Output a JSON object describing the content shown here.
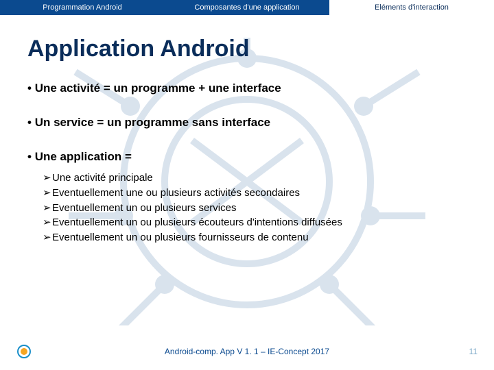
{
  "tabs": {
    "t0": "Programmation Android",
    "t1": "Composantes d'une application",
    "t2": "Eléments d'interaction"
  },
  "title": "Application Android",
  "bullets": {
    "b0": "Une activité = un programme + une interface",
    "b1": "Un service = un programme sans interface",
    "b2": "Une application ="
  },
  "subbullets": {
    "s0": "Une activité principale",
    "s1": "Eventuellement une ou plusieurs activités secondaires",
    "s2": "Eventuellement un ou plusieurs services",
    "s3": "Eventuellement un ou plusieurs écouteurs d'intentions diffusées",
    "s4": "Eventuellement un ou plusieurs fournisseurs de contenu"
  },
  "arrow_glyph": "➢",
  "footer": "Android-comp. App V 1. 1 – IE-Concept 2017",
  "page_number": "11"
}
